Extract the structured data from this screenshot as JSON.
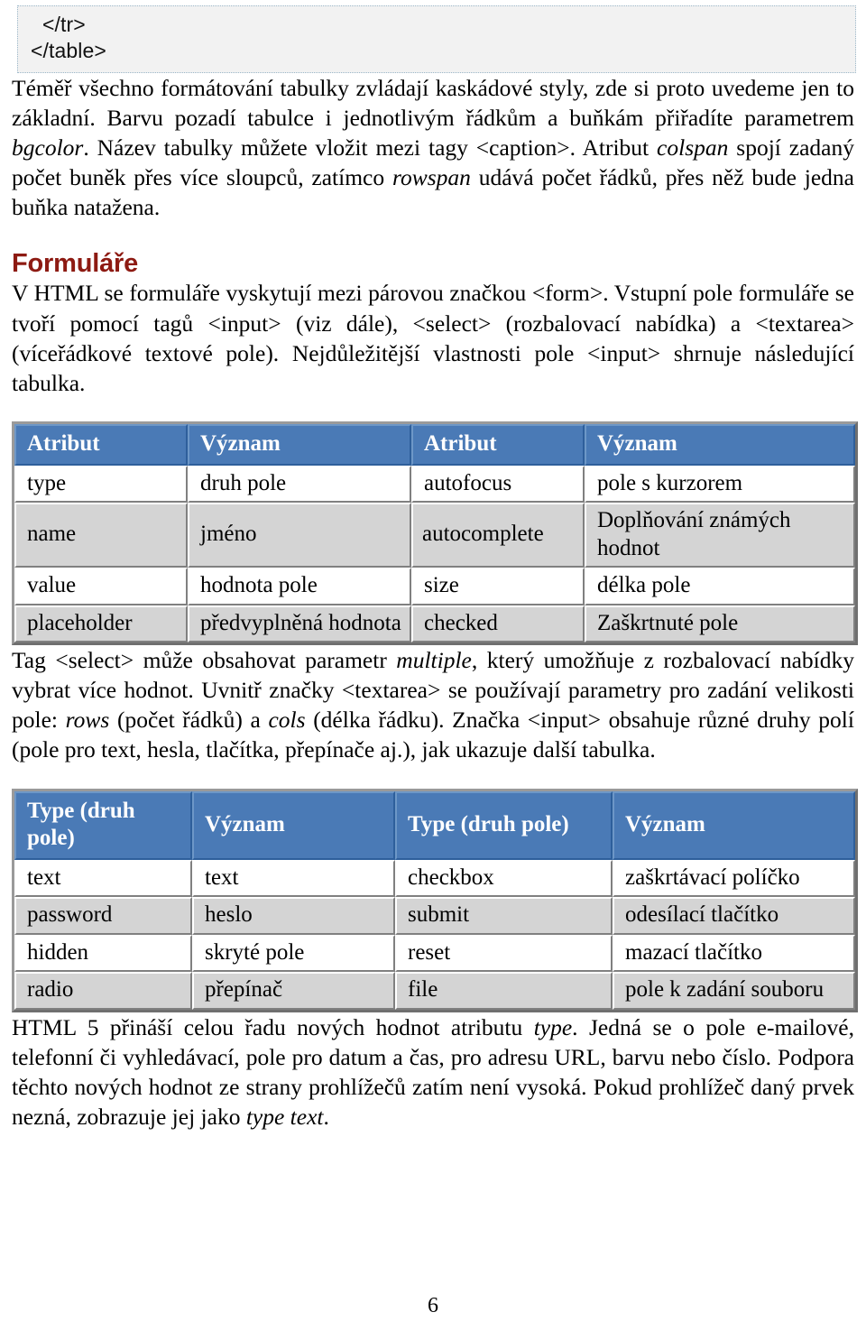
{
  "code_block": {
    "lines": [
      "  </tr>",
      "</table>"
    ]
  },
  "paragraphs": {
    "intro": "Téměř všechno formátování tabulky zvládají kaskádové styly, zde si proto uvedeme jen to základní. Barvu pozadí tabulce i jednotlivým řádkům a buňkám přiřadíte parametrem <em>bgcolor</em>. Název tabulky můžete vložit mezi tagy &lt;caption&gt;. Atribut <em>colspan</em> spojí zadaný počet buněk přes více sloupců, zatímco <em>rowspan</em> udává počet řádků, přes něž bude jedna buňka natažena.",
    "forms_intro": "V HTML se formuláře vyskytují mezi párovou značkou &lt;form&gt;. Vstupní pole formuláře se tvoří pomocí tagů &lt;input&gt; (viz dále), &lt;select&gt; (rozbalovací nabídka) a &lt;textarea&gt; (víceřádkové textové pole). Nejdůležitější vlastnosti pole &lt;input&gt; shrnuje následující tabulka.",
    "select_textarea": "Tag &lt;select&gt; může obsahovat parametr <em>multiple</em>, který umožňuje z rozbalovací nabídky vybrat více hodnot. Uvnitř značky &lt;textarea&gt; se používají parametry pro zadání velikosti pole: <em>rows</em> (počet řádků) a <em>cols</em> (délka řádku). Značka &lt;input&gt; obsahuje různé druhy polí (pole pro text, hesla, tlačítka, přepínače aj.), jak ukazuje další tabulka.",
    "html5_types": "HTML 5 přináší celou řadu nových hodnot atributu <em>type</em>. Jedná se o pole e-mailové, telefonní či vyhledávací, pole pro datum a čas, pro adresu URL, barvu nebo číslo. Podpora těchto nových hodnot ze strany prohlížečů zatím není vysoká. Pokud prohlížeč daný prvek nezná, zobrazuje jej jako <em>type text</em>."
  },
  "headings": {
    "forms": "Formuláře"
  },
  "table_input_attributes": {
    "headers": [
      "Atribut",
      "Význam",
      "Atribut",
      "Význam"
    ],
    "rows": [
      [
        "type",
        "druh pole",
        "autofocus",
        "pole s kurzorem"
      ],
      [
        "name",
        "jméno",
        "autocomplete",
        "Doplňování známých hodnot"
      ],
      [
        "value",
        "hodnota pole",
        "size",
        "délka pole"
      ],
      [
        "placeholder",
        "předvyplněná hodnota",
        "checked",
        "Zaškrtnuté pole"
      ]
    ]
  },
  "table_input_types": {
    "headers": [
      "Type (druh pole)",
      "Význam",
      "Type (druh pole)",
      "Význam"
    ],
    "rows": [
      [
        "text",
        "text",
        "checkbox",
        "zaškrtávací políčko"
      ],
      [
        "password",
        "heslo",
        "submit",
        "odesílací tlačítko"
      ],
      [
        "hidden",
        "skryté pole",
        "reset",
        "mazací tlačítko"
      ],
      [
        "radio",
        "přepínač",
        "file",
        "pole k zadání souboru"
      ]
    ]
  },
  "footer": {
    "page_number": "6"
  },
  "colors": {
    "heading": "#8d1a12",
    "table_header_bg": "#4a7ab6",
    "table_header_text": "#ffffff",
    "table_row_alt_bg": "#d4d4d4",
    "code_bg": "#f2f2f2"
  }
}
